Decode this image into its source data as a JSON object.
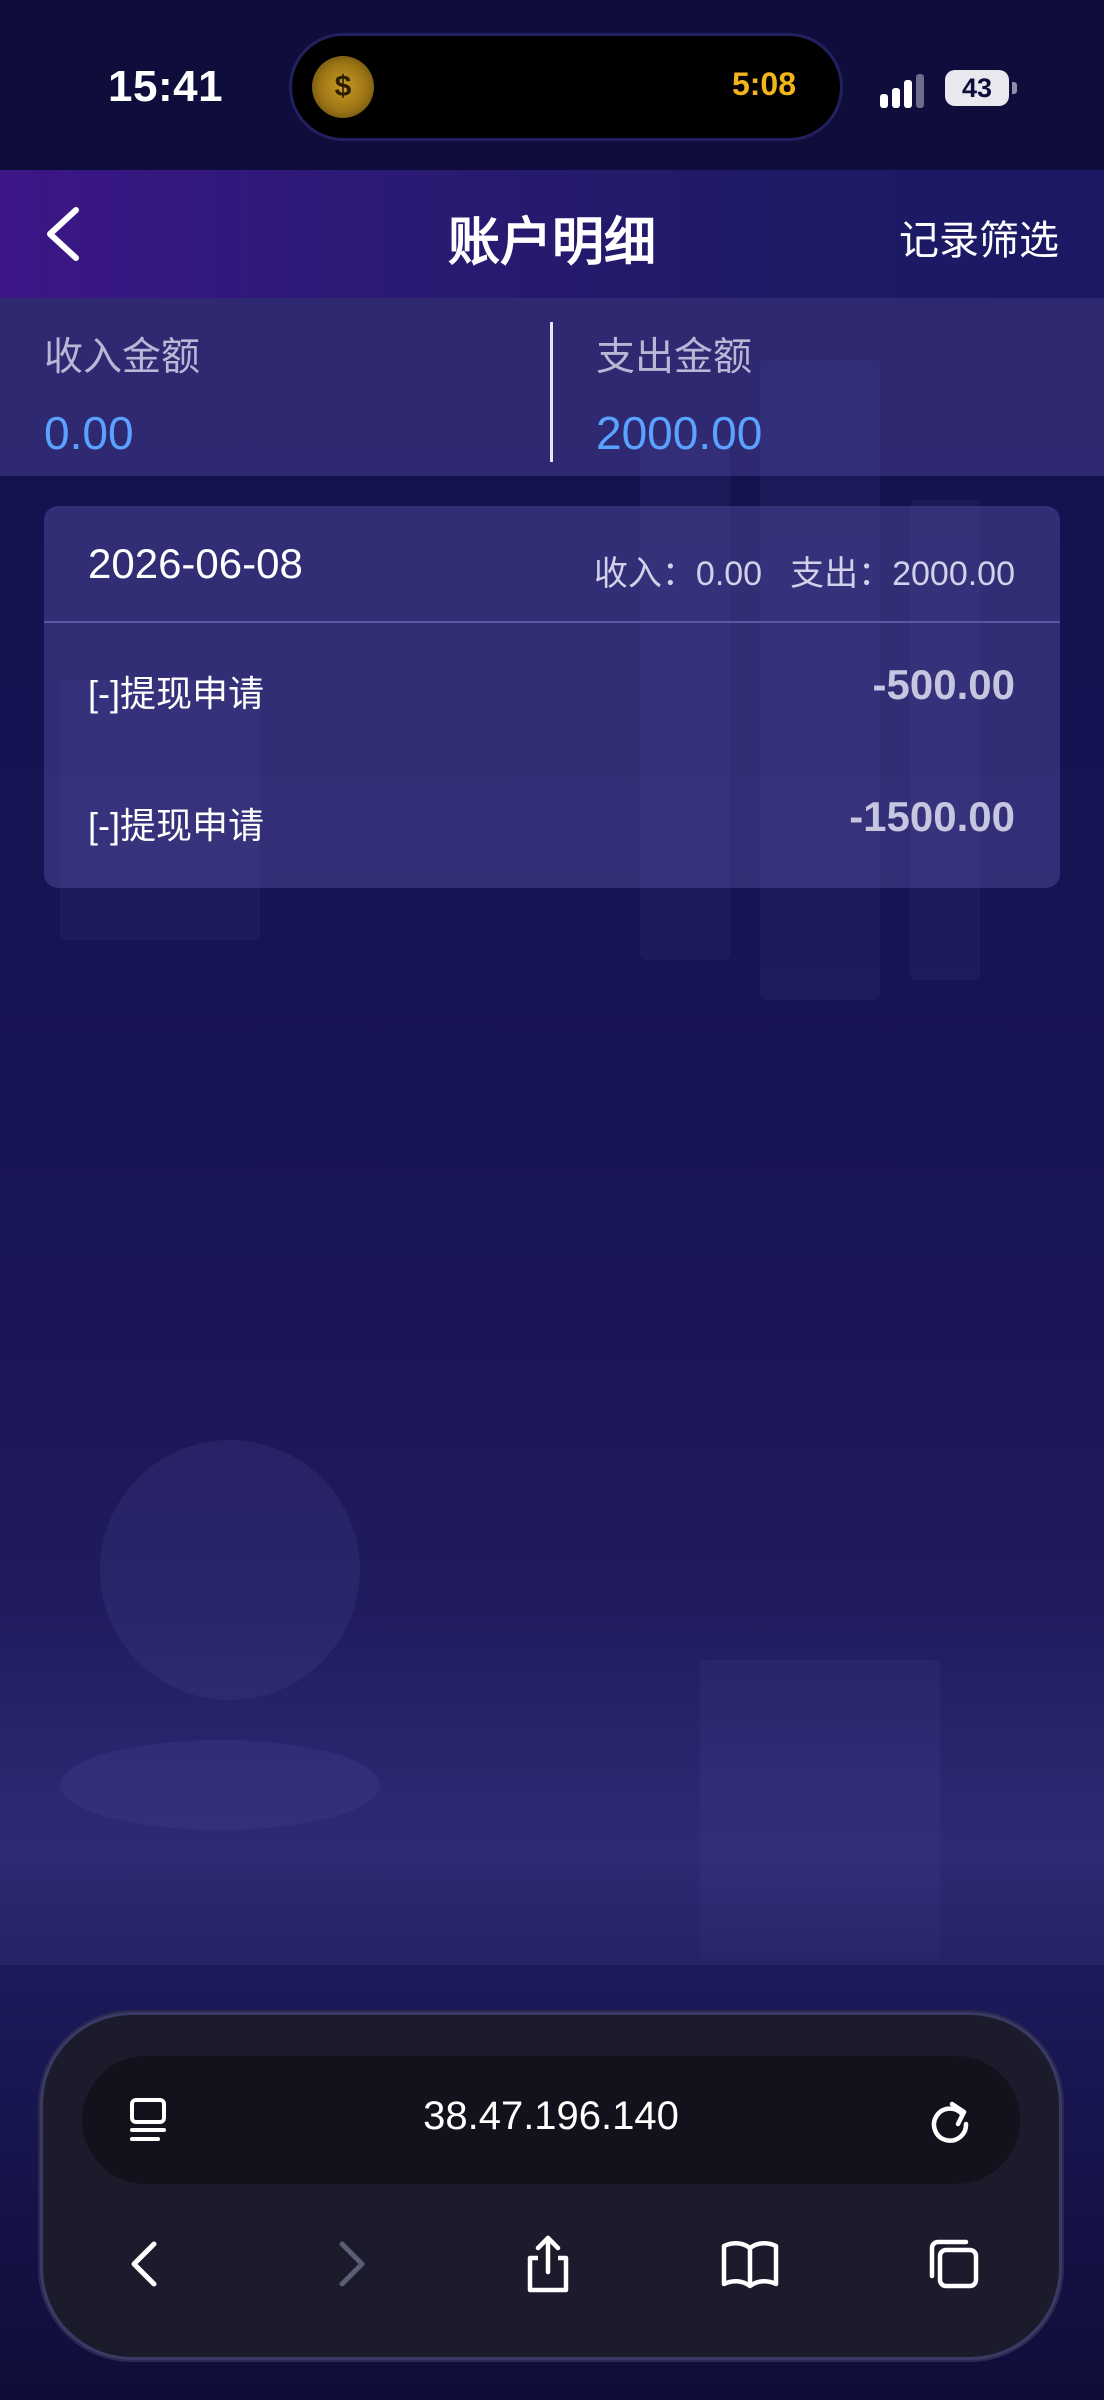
{
  "status_bar": {
    "time": "15:41",
    "island_coin_symbol": "$",
    "island_timer": "5:08",
    "battery": "43"
  },
  "header": {
    "back_icon": "chevron-left-icon",
    "title": "账户明细",
    "filter_label": "记录筛选"
  },
  "summary": {
    "income_label": "收入金额",
    "income_value": "0.00",
    "expense_label": "支出金额",
    "expense_value": "2000.00",
    "value_color": "#5aa2ff"
  },
  "records": {
    "date": "2026-06-08",
    "income_total": "收入：0.00",
    "expense_total": "支出：2000.00",
    "items": [
      {
        "title": "[-]提现申请",
        "amount": "-500.00"
      },
      {
        "title": "[-]提现申请",
        "amount": "-1500.00"
      }
    ]
  },
  "browser": {
    "url": "38.47.196.140",
    "icons": [
      "reader-icon",
      "reload-icon",
      "back-icon",
      "forward-icon",
      "share-icon",
      "bookmarks-icon",
      "tabs-icon"
    ]
  }
}
